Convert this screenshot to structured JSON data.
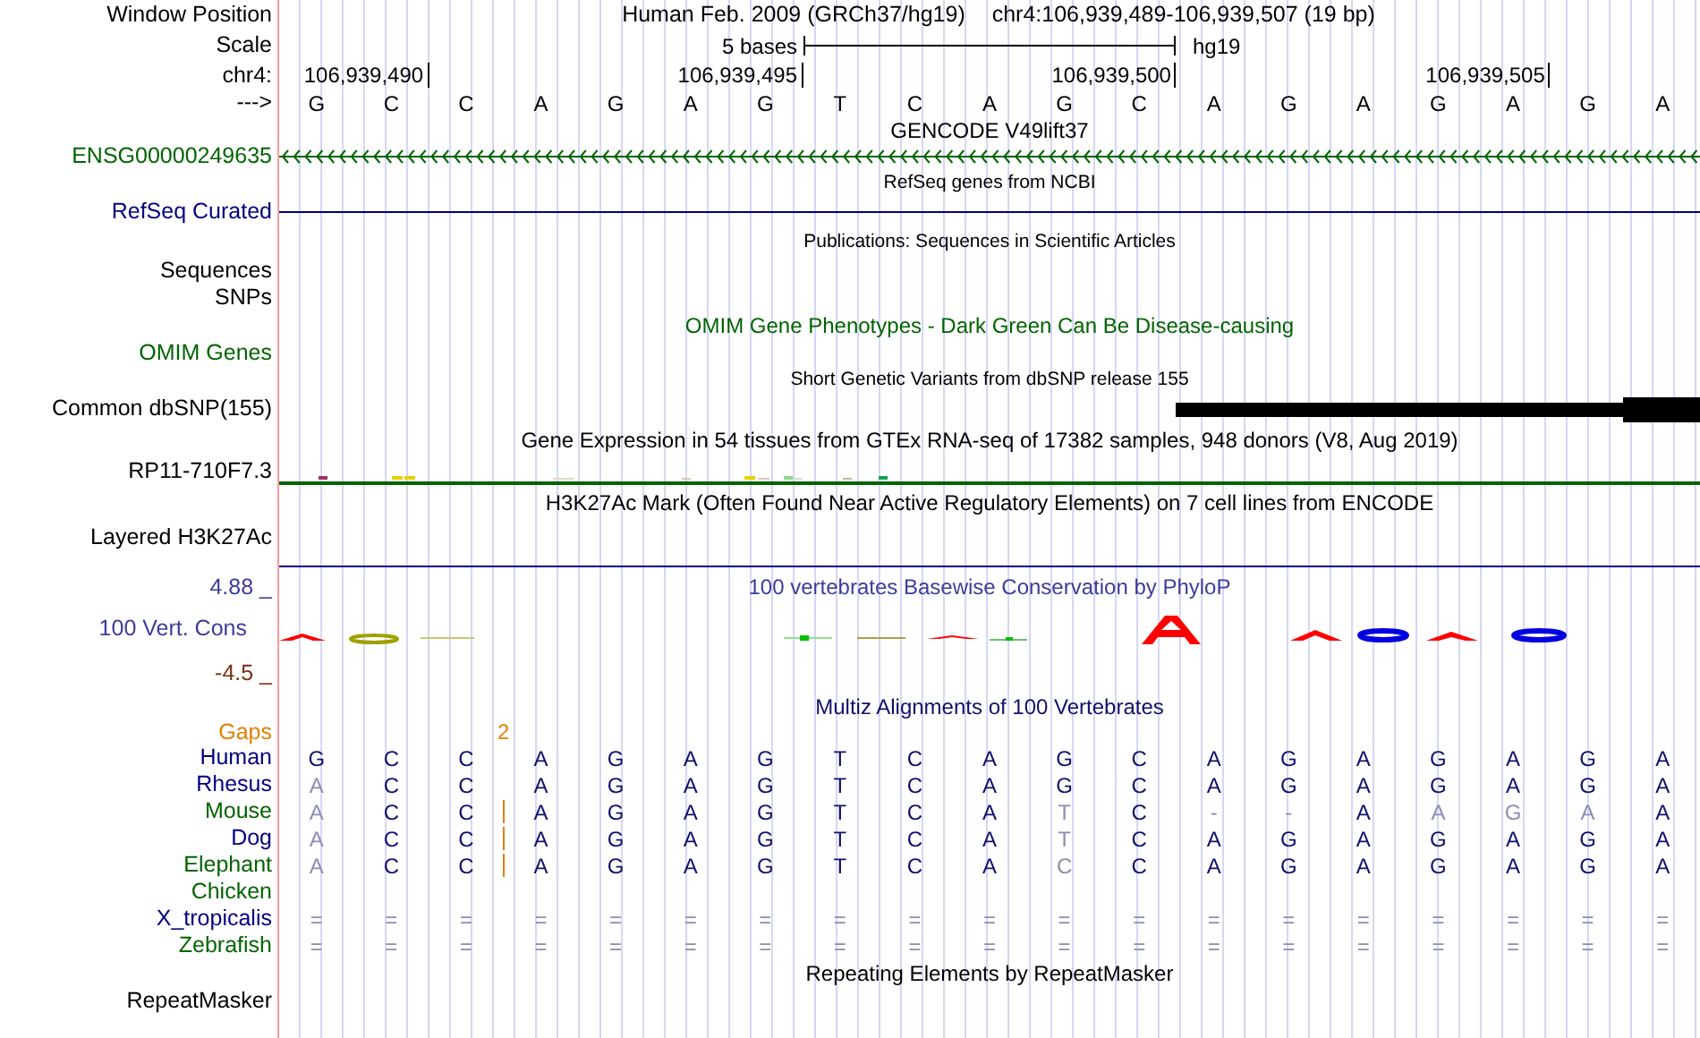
{
  "header": {
    "window_position": {
      "label": "Window Position",
      "assembly": "Human Feb. 2009 (GRCh37/hg19)",
      "range": "chr4:106,939,489-106,939,507 (19 bp)"
    },
    "scale": {
      "label": "Scale",
      "size": "5 bases",
      "assembly": "hg19"
    },
    "ruler": {
      "label": "chr4:",
      "ticks": [
        "106,939,490",
        "106,939,495",
        "106,939,500",
        "106,939,505"
      ]
    },
    "sequence": {
      "label": "--->",
      "bases": [
        "G",
        "C",
        "C",
        "A",
        "G",
        "A",
        "G",
        "T",
        "C",
        "A",
        "G",
        "C",
        "A",
        "G",
        "A",
        "G",
        "A",
        "G",
        "A"
      ]
    }
  },
  "tracks": [
    {
      "kind": "gene",
      "title": "GENCODE V49lift37",
      "small_title": false,
      "label": "ENSG00000249635",
      "color": "#006400"
    },
    {
      "kind": "line",
      "title": "RefSeq genes from NCBI",
      "small_title": true,
      "label": "RefSeq Curated",
      "color": "#000080"
    },
    {
      "kind": "empty",
      "title": "Publications: Sequences in Scientific Articles",
      "small_title": true,
      "labels": [
        "Sequences",
        "SNPs"
      ]
    },
    {
      "kind": "empty",
      "title": "OMIM Gene Phenotypes - Dark Green Can Be Disease-causing",
      "small_title": false,
      "labels": [
        "OMIM Genes"
      ],
      "color": "#006400"
    },
    {
      "kind": "variants",
      "title": "Short Genetic Variants from dbSNP release 155",
      "small_title": true,
      "label": "Common dbSNP(155)"
    },
    {
      "kind": "expression",
      "title": "Gene Expression in 54 tissues from GTEx RNA-seq of 17382 samples, 948 donors (V8, Aug 2019)",
      "small_title": false,
      "label": "RP11-710F7.3"
    },
    {
      "kind": "signal",
      "title": "H3K27Ac Mark (Often Found Near Active Regulatory Elements) on 7 cell lines from ENCODE",
      "small_title": false,
      "label": "Layered H3K27Ac",
      "color": "#000080"
    },
    {
      "kind": "conservation",
      "title": "100 vertebrates Basewise Conservation by PhyloP",
      "small_title": false,
      "label": "100 Vert. Cons",
      "max": "4.88 _",
      "min": "-4.5 _",
      "color": "#3c3c9c"
    },
    {
      "kind": "alignment",
      "title": "Multiz Alignments of 100 Vertebrates",
      "small_title": false,
      "gaps": {
        "label": "Gaps",
        "count": "2"
      },
      "species": [
        {
          "name": "Human",
          "color": "#000080",
          "insertion": false,
          "bases": [
            "G",
            "C",
            "C",
            "A",
            "G",
            "A",
            "G",
            "T",
            "C",
            "A",
            "G",
            "C",
            "A",
            "G",
            "A",
            "G",
            "A",
            "G",
            "A"
          ],
          "faded": [
            false,
            false,
            false,
            false,
            false,
            false,
            false,
            false,
            false,
            false,
            false,
            false,
            false,
            false,
            false,
            false,
            false,
            false,
            false
          ]
        },
        {
          "name": "Rhesus",
          "color": "#000080",
          "insertion": false,
          "bases": [
            "A",
            "C",
            "C",
            "A",
            "G",
            "A",
            "G",
            "T",
            "C",
            "A",
            "G",
            "C",
            "A",
            "G",
            "A",
            "G",
            "A",
            "G",
            "A"
          ],
          "faded": [
            true,
            false,
            false,
            false,
            false,
            false,
            false,
            false,
            false,
            false,
            false,
            false,
            false,
            false,
            false,
            false,
            false,
            false,
            false
          ]
        },
        {
          "name": "Mouse",
          "color": "#006400",
          "insertion": true,
          "bases": [
            "A",
            "C",
            "C",
            "A",
            "G",
            "A",
            "G",
            "T",
            "C",
            "A",
            "T",
            "C",
            "-",
            "-",
            "A",
            "A",
            "G",
            "A",
            "A"
          ],
          "faded": [
            true,
            false,
            false,
            false,
            false,
            false,
            false,
            false,
            false,
            false,
            true,
            false,
            true,
            true,
            false,
            true,
            true,
            true,
            false
          ]
        },
        {
          "name": "Dog",
          "color": "#000080",
          "insertion": true,
          "bases": [
            "A",
            "C",
            "C",
            "A",
            "G",
            "A",
            "G",
            "T",
            "C",
            "A",
            "T",
            "C",
            "A",
            "G",
            "A",
            "G",
            "A",
            "G",
            "A"
          ],
          "faded": [
            true,
            false,
            false,
            false,
            false,
            false,
            false,
            false,
            false,
            false,
            true,
            false,
            false,
            false,
            false,
            false,
            false,
            false,
            false
          ]
        },
        {
          "name": "Elephant",
          "color": "#006400",
          "insertion": true,
          "bases": [
            "A",
            "C",
            "C",
            "A",
            "G",
            "A",
            "G",
            "T",
            "C",
            "A",
            "C",
            "C",
            "A",
            "G",
            "A",
            "G",
            "A",
            "G",
            "A"
          ],
          "faded": [
            true,
            false,
            false,
            false,
            false,
            false,
            false,
            false,
            false,
            false,
            true,
            false,
            false,
            false,
            false,
            false,
            false,
            false,
            false
          ]
        },
        {
          "name": "Chicken",
          "color": "#006400",
          "insertion": false
        },
        {
          "name": "X_tropicalis",
          "color": "#000080",
          "insertion": false,
          "bases": [
            "=",
            "=",
            "=",
            "=",
            "=",
            "=",
            "=",
            "=",
            "=",
            "=",
            "=",
            "=",
            "=",
            "=",
            "=",
            "=",
            "=",
            "=",
            "="
          ],
          "faded": [
            true,
            true,
            true,
            true,
            true,
            true,
            true,
            true,
            true,
            true,
            true,
            true,
            true,
            true,
            true,
            true,
            true,
            true,
            true
          ]
        },
        {
          "name": "Zebrafish",
          "color": "#006400",
          "insertion": false,
          "bases": [
            "=",
            "=",
            "=",
            "=",
            "=",
            "=",
            "=",
            "=",
            "=",
            "=",
            "=",
            "=",
            "=",
            "=",
            "=",
            "=",
            "=",
            "=",
            "="
          ],
          "faded": [
            true,
            true,
            true,
            true,
            true,
            true,
            true,
            true,
            true,
            true,
            true,
            true,
            true,
            true,
            true,
            true,
            true,
            true,
            true
          ]
        }
      ]
    },
    {
      "kind": "empty",
      "title": "Repeating Elements by RepeatMasker",
      "small_title": false,
      "labels": [
        "RepeatMasker"
      ]
    }
  ]
}
